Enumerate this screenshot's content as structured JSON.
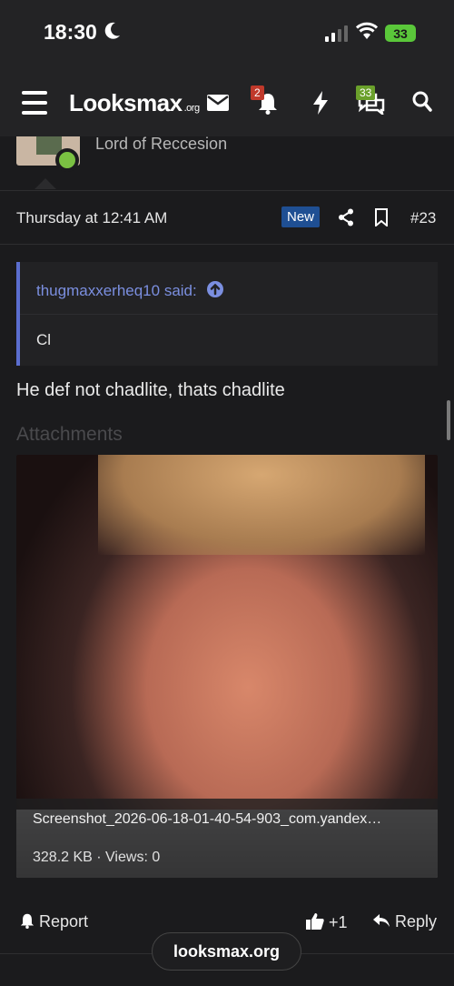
{
  "status_bar": {
    "time": "18:30",
    "battery": "33"
  },
  "header": {
    "logo_main": "Looksmax",
    "logo_tld": ".org",
    "alerts_badge": "2",
    "conversations_badge": "33"
  },
  "post": {
    "user_title": "Lord of Reccesion",
    "date": "Thursday at 12:41 AM",
    "new_badge": "New",
    "number": "#23",
    "quote": {
      "author": "thugmaxxerheq10 said:",
      "text": "Cl"
    },
    "text": "He def not chadlite, thats chadlite",
    "attachments_label": "Attachments",
    "attachment": {
      "file_name": "Screenshot_2026-06-18-01-40-54-903_com.yandex…",
      "meta": "328.2 KB · Views: 0"
    },
    "actions": {
      "report": "Report",
      "like": "+1",
      "reply": "Reply"
    }
  },
  "browser": {
    "url": "looksmax.org"
  },
  "colors": {
    "background": "#1b1b1d",
    "link": "#7b8fe0",
    "new_badge": "#1f4f93",
    "online": "#7ac142"
  }
}
